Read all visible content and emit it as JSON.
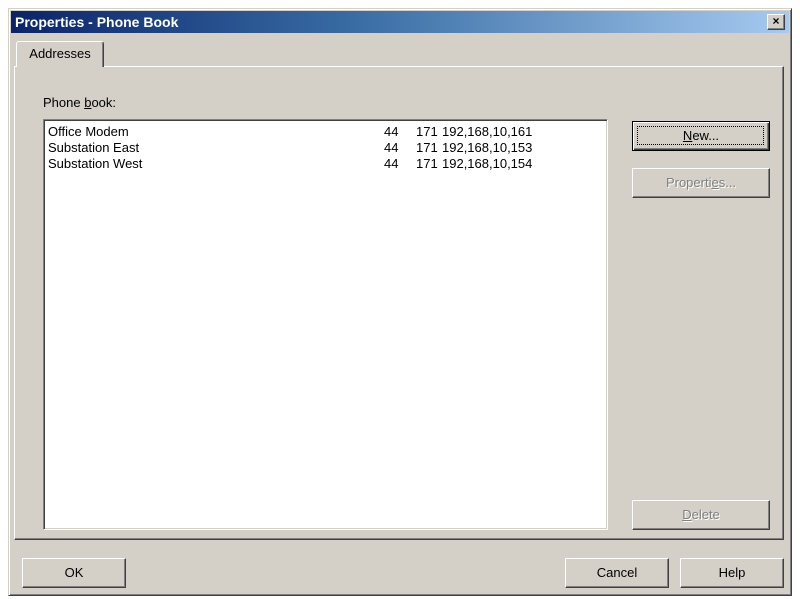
{
  "window": {
    "title": "Properties - Phone Book",
    "close_label": "×"
  },
  "tabs": [
    {
      "label": "Addresses"
    }
  ],
  "phonebook": {
    "label_before": "Phone ",
    "label_hotkey": "b",
    "label_after": "ook:",
    "entries": [
      {
        "name": "Office Modem",
        "code1": "44",
        "code2": "171",
        "address": "192,168,10,161"
      },
      {
        "name": "Substation East",
        "code1": "44",
        "code2": "171",
        "address": "192,168,10,153"
      },
      {
        "name": "Substation West",
        "code1": "44",
        "code2": "171",
        "address": "192,168,10,154"
      }
    ]
  },
  "buttons": {
    "new": {
      "hotkey": "N",
      "rest": "ew..."
    },
    "properties": {
      "before": "Properti",
      "hotkey": "e",
      "after": "s..."
    },
    "delete": {
      "hotkey": "D",
      "rest": "elete"
    },
    "ok": "OK",
    "cancel": "Cancel",
    "help": "Help"
  }
}
